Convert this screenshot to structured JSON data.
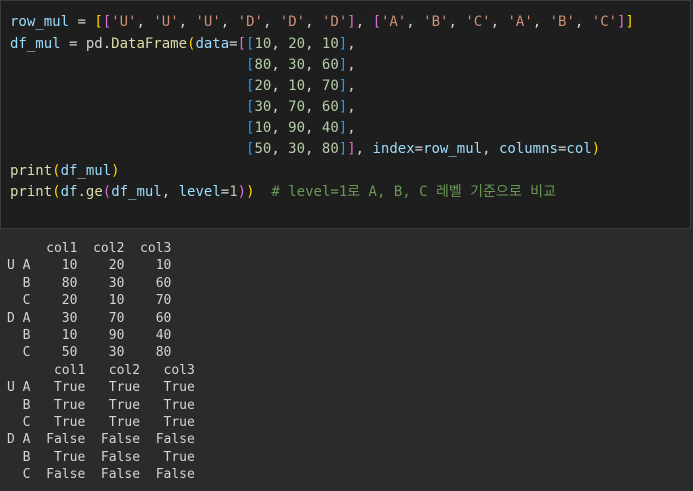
{
  "code_cell": {
    "lines": [
      "row_mul = [['U', 'U', 'U', 'D', 'D', 'D'], ['A', 'B', 'C', 'A', 'B', 'C']]",
      "df_mul = pd.DataFrame(data=[[10, 20, 10],",
      "                            [80, 30, 60],",
      "                            [20, 10, 70],",
      "                            [30, 70, 60],",
      "                            [10, 90, 40],",
      "                            [50, 30, 80]], index=row_mul, columns=col)",
      "print(df_mul)",
      "print(df.ge(df_mul, level=1))  # level=1로 A, B, C 레벨 기준으로 비교"
    ]
  },
  "output": {
    "lines": [
      "     col1  col2  col3",
      "U A    10    20    10",
      "  B    80    30    60",
      "  C    20    10    70",
      "D A    30    70    60",
      "  B    10    90    40",
      "  C    50    30    80",
      "      col1   col2   col3",
      "U A   True   True   True",
      "  B   True   True   True",
      "  C   True   True   True",
      "D A  False  False  False",
      "  B   True  False   True",
      "  C  False  False  False"
    ]
  }
}
